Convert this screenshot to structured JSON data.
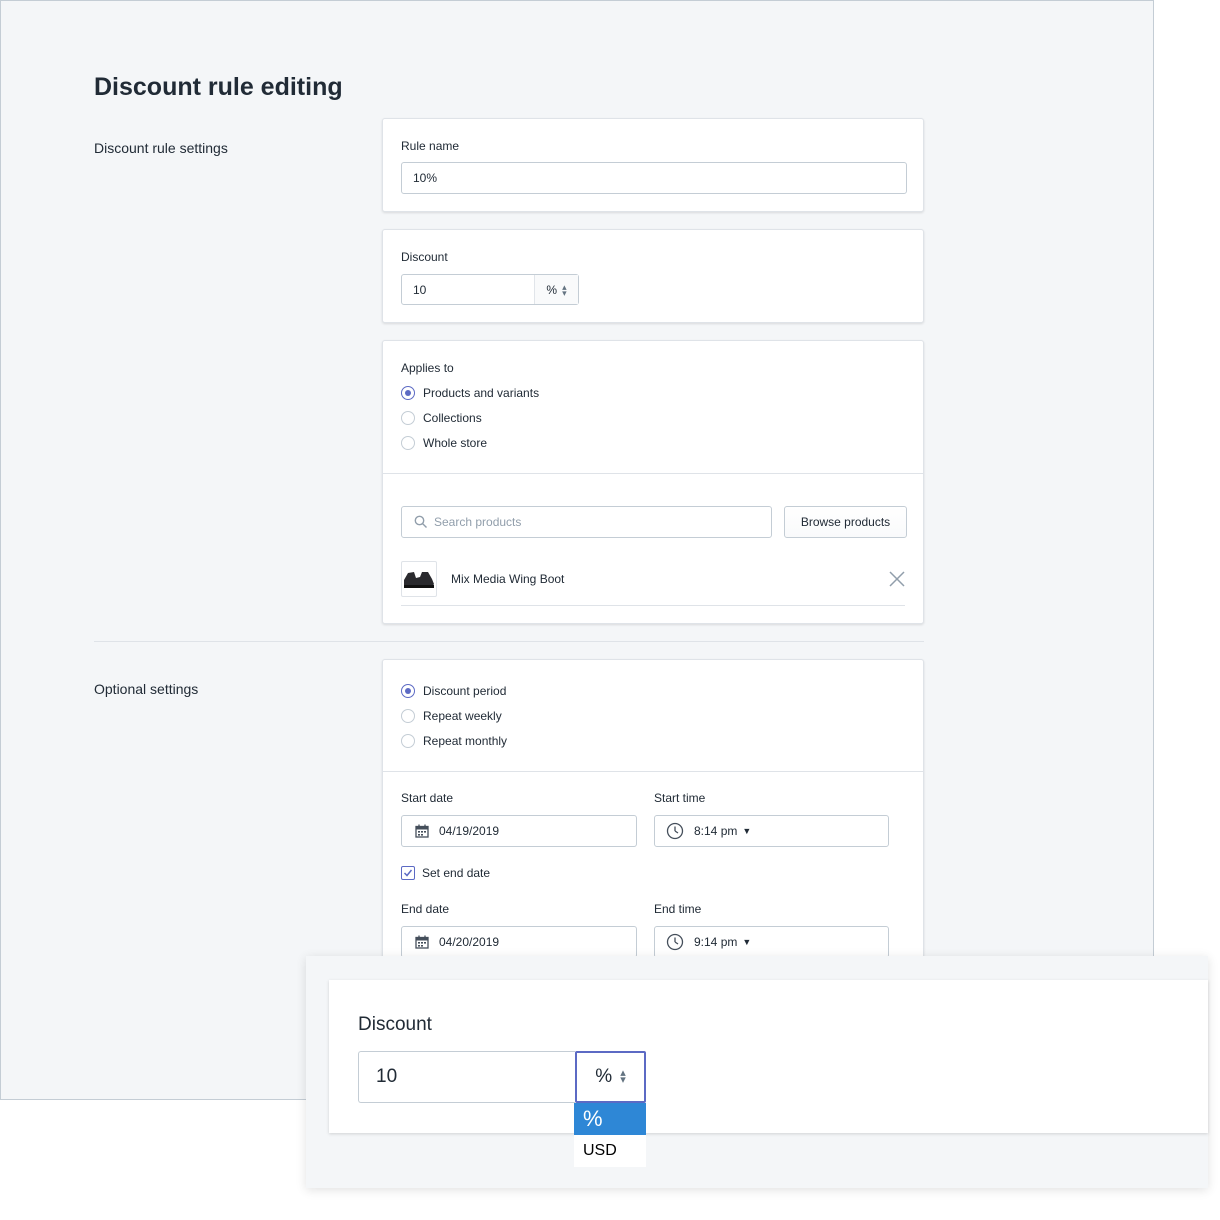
{
  "page": {
    "title": "Discount rule editing",
    "section_rule_settings": "Discount rule settings",
    "section_optional": "Optional settings"
  },
  "rule_name": {
    "label": "Rule name",
    "value": "10%"
  },
  "discount": {
    "label": "Discount",
    "value": "10",
    "unit": "%"
  },
  "applies_to": {
    "label": "Applies to",
    "options": [
      "Products and variants",
      "Collections",
      "Whole store"
    ],
    "selected": "Products and variants",
    "search_placeholder": "Search products",
    "browse_label": "Browse products",
    "product_name": "Mix Media Wing Boot"
  },
  "period": {
    "options": [
      "Discount period",
      "Repeat weekly",
      "Repeat monthly"
    ],
    "selected": "Discount period",
    "start_date_label": "Start date",
    "start_date": "04/19/2019",
    "start_time_label": "Start time",
    "start_time": "8:14 pm",
    "set_end_date_label": "Set end date",
    "set_end_date_checked": true,
    "end_date_label": "End date",
    "end_date": "04/20/2019",
    "end_time_label": "End time",
    "end_time": "9:14 pm"
  },
  "zoom": {
    "label": "Discount",
    "value": "10",
    "unit": "%",
    "options": [
      "%",
      "USD"
    ],
    "selected": "%"
  },
  "colors": {
    "accent": "#5c6ac4",
    "highlight": "#2e87d6",
    "background": "#f4f6f8"
  }
}
